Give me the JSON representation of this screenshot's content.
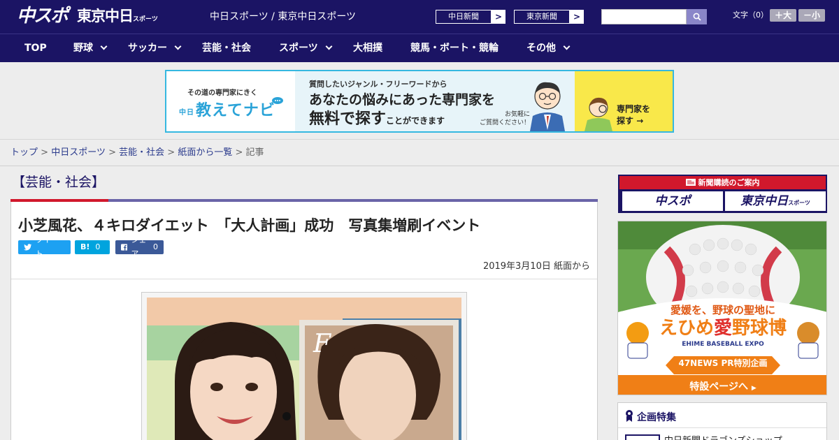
{
  "header": {
    "logo_chuspo": "中スポ",
    "logo_tokyo": "東京中日",
    "logo_tokyo_sub": "スポーツ",
    "site_title": "中日スポーツ / 東京中日スポーツ",
    "paper_buttons": [
      {
        "label": "中日新聞",
        "arrow": ">"
      },
      {
        "label": "東京新聞",
        "arrow": ">"
      }
    ],
    "search_placeholder": "",
    "font_size_label": "文字（0）",
    "size_up": "＋大",
    "size_down": "－小"
  },
  "nav": {
    "items": [
      {
        "label": "TOP",
        "has_menu": false
      },
      {
        "label": "野球",
        "has_menu": true
      },
      {
        "label": "サッカー",
        "has_menu": true
      },
      {
        "label": "芸能・社会",
        "has_menu": false
      },
      {
        "label": "スポーツ",
        "has_menu": true
      },
      {
        "label": "大相撲",
        "has_menu": false
      },
      {
        "label": "競馬・ボート・競輪",
        "has_menu": false
      },
      {
        "label": "その他",
        "has_menu": true
      }
    ]
  },
  "banner": {
    "tag": "その道の専門家にきく",
    "brand_prefix": "中日",
    "brand": "教えてナビ",
    "line1": "質問したいジャンル・フリーワードから",
    "line2": "あなたの悩みにあった専門家を",
    "line3_big": "無料で探す",
    "line3_small": "ことができます",
    "line4a": "お気軽に",
    "line4b": "ご質問ください！",
    "cta_a": "専門家を",
    "cta_b": "探す",
    "cta_arrow": "→"
  },
  "breadcrumb": {
    "items": [
      "トップ",
      "中日スポーツ",
      "芸能・社会",
      "紙面から一覧"
    ],
    "current": "記事",
    "separator": ">"
  },
  "section": {
    "title": "【芸能・社会】"
  },
  "article": {
    "headline": "小芝風花、４キロダイエット　「大人計画」成功　写真集増刷イベント",
    "share": {
      "tweet_label": "ツイート",
      "hatena_label": "B!",
      "hatena_count": "0",
      "facebook_label": "シェア",
      "facebook_count": "0"
    },
    "date": "2019年3月10日",
    "source": "紙面から",
    "photo_book_letter": "F"
  },
  "sidebar": {
    "subscription_head": "新聞購読のご案内",
    "sub_buttons": [
      {
        "label": "中スポ",
        "sub": ""
      },
      {
        "label": "東京中日",
        "sub": "スポーツ"
      }
    ],
    "expo": {
      "catch": "愛媛を、野球の聖地に",
      "title_a": "えひめ",
      "title_b": "愛",
      "title_c": "野球博",
      "subtitle": "EHIME BASEBALL EXPO",
      "pr": "47NEWS PR特別企画",
      "cta": "特設ページへ"
    },
    "kikaku_title": "企画特集",
    "kikaku_item": "中日新聞ドラゴンズショップ"
  },
  "colors": {
    "navy": "#1b1464",
    "red": "#d1182c",
    "banner_border": "#35b8e0",
    "twitter": "#1da1f2",
    "hatena": "#00a4de",
    "facebook": "#3b5998",
    "expo_orange": "#f07f16"
  }
}
